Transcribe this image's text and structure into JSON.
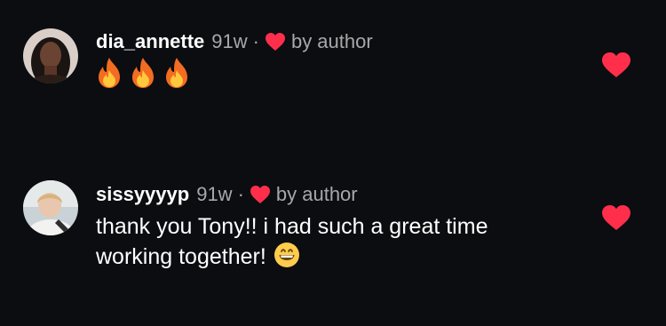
{
  "comments": [
    {
      "username": "dia_annette",
      "time": "91w",
      "separator": "·",
      "liked_by": "by author",
      "text": "",
      "emojis": [
        "fire",
        "fire",
        "fire"
      ]
    },
    {
      "username": "sissyyyyp",
      "time": "91w",
      "separator": "·",
      "liked_by": "by author",
      "text_line1": "thank you Tony!! i had such a great time",
      "text_line2": "working together!",
      "trailing_emoji": "grinning-face"
    }
  ],
  "colors": {
    "background": "#0b0d11",
    "heart": "#ff2f4c",
    "muted_text": "#a8a8a8"
  }
}
